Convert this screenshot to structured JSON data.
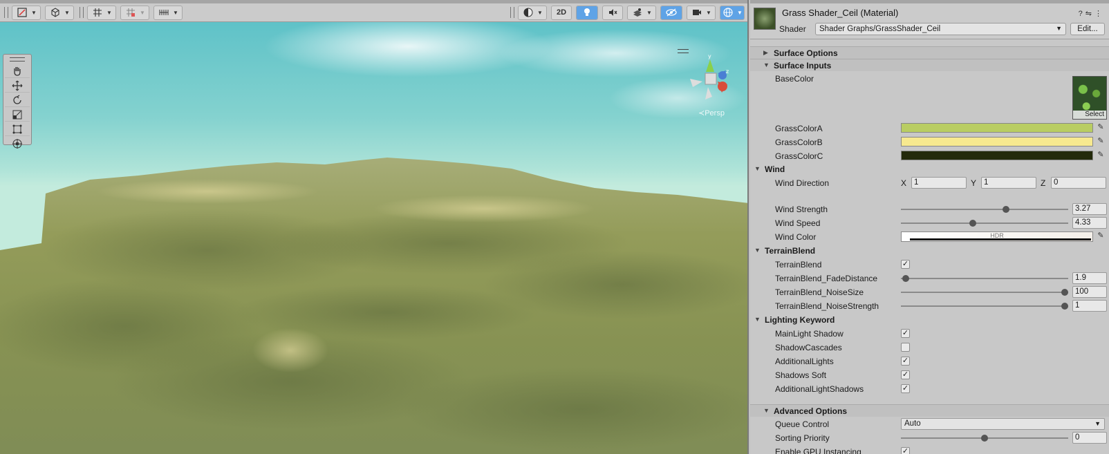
{
  "scene": {
    "toolbar": {
      "tools": [
        "gizmo-draw-icon",
        "camera-cube-icon",
        "grid-icon",
        "snap-icon",
        "ruler-icon"
      ],
      "right": {
        "shading_icon": "sphere-shading-icon",
        "mode_2d": "2D",
        "light_icon": "light-bulb-icon",
        "audio_icon": "audio-mute-icon",
        "fx_icon": "effects-icon",
        "visibility_icon": "hidden-eye-icon",
        "camera_icon": "camera-icon",
        "gizmos_icon": "gizmo-globe-icon"
      }
    },
    "palette": [
      "hand-icon",
      "move-icon",
      "rotate-icon",
      "scale-icon",
      "rect-icon",
      "transform-icon"
    ],
    "gizmo": {
      "y": "y",
      "z": "z",
      "persp": "≺Persp"
    },
    "colors": {
      "sky": "#7fd0ce",
      "terrain": "#8e9a57"
    }
  },
  "inspector": {
    "material_title": "Grass Shader_Ceil (Material)",
    "shader_label": "Shader",
    "shader_value": "Shader Graphs/GrassShader_Ceil",
    "edit_label": "Edit...",
    "sections": {
      "surface_options": "Surface Options",
      "surface_inputs": "Surface Inputs",
      "wind": "Wind",
      "terrain_blend": "TerrainBlend",
      "lighting_keyword": "Lighting Keyword",
      "advanced_options": "Advanced Options"
    },
    "base_color": {
      "label": "BaseColor",
      "select": "Select"
    },
    "colors": [
      {
        "label": "GrassColorA",
        "hex": "#b9cd62"
      },
      {
        "label": "GrassColorB",
        "hex": "#f7e98f"
      },
      {
        "label": "GrassColorC",
        "hex": "#232a0b"
      }
    ],
    "wind_direction": {
      "label": "Wind Direction",
      "x_label": "X",
      "x": "1",
      "y_label": "Y",
      "y": "1",
      "z_label": "Z",
      "z": "0"
    },
    "wind_strength": {
      "label": "Wind Strength",
      "value": "3.27",
      "fraction": 0.63
    },
    "wind_speed": {
      "label": "Wind Speed",
      "value": "4.33",
      "fraction": 0.43
    },
    "wind_color": {
      "label": "Wind Color",
      "hdr": "HDR"
    },
    "terrain_blend_toggle": {
      "label": "TerrainBlend",
      "checked": true
    },
    "fade_distance": {
      "label": "TerrainBlend_FadeDistance",
      "value": "1.9",
      "fraction": 0.03
    },
    "noise_size": {
      "label": "TerrainBlend_NoiseSize",
      "value": "100",
      "fraction": 0.98
    },
    "noise_strength": {
      "label": "TerrainBlend_NoiseStrength",
      "value": "1",
      "fraction": 0.98
    },
    "keywords": [
      {
        "label": "MainLight Shadow",
        "checked": true
      },
      {
        "label": "ShadowCascades",
        "checked": false
      },
      {
        "label": "AdditionalLights",
        "checked": true
      },
      {
        "label": "Shadows Soft",
        "checked": true
      },
      {
        "label": "AdditionalLightShadows",
        "checked": true
      }
    ],
    "queue_control": {
      "label": "Queue Control",
      "value": "Auto"
    },
    "sorting_priority": {
      "label": "Sorting Priority",
      "value": "0",
      "fraction": 0.5
    },
    "gpu_instancing": {
      "label": "Enable GPU Instancing",
      "checked": true
    },
    "header_icons": [
      "help-icon",
      "preset-icon",
      "more-icon"
    ]
  }
}
